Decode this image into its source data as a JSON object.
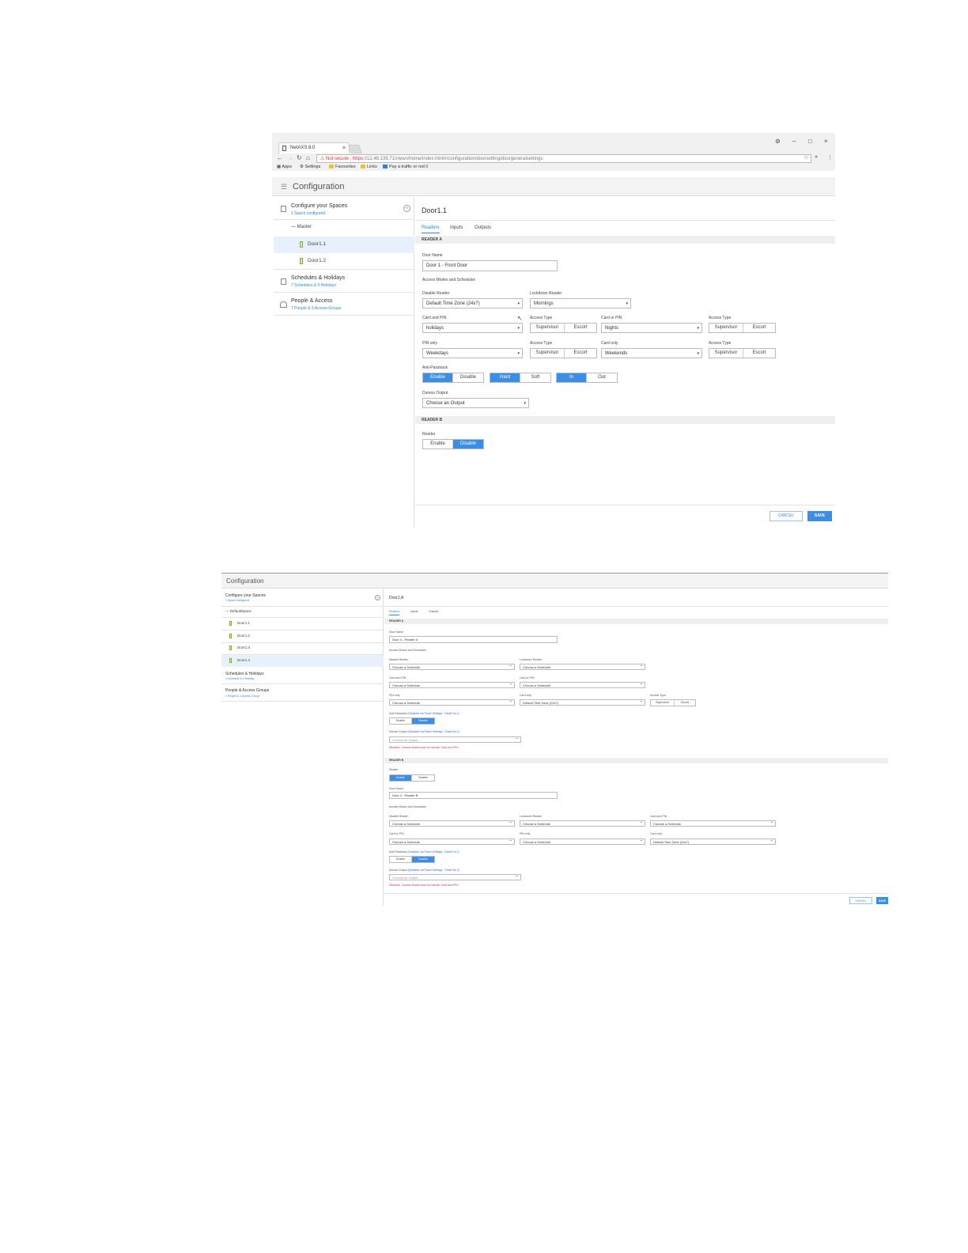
{
  "screen1": {
    "browser": {
      "tab_title": "NetAXS 8.0",
      "tab_close": "×",
      "window_controls": [
        "⊚",
        "–",
        "□",
        "×"
      ],
      "not_secure": "Not secure",
      "url_https": "https",
      "url_rest": "://12.48.139.71/views/home/index.html#/configuration/doorsetting/doorgeneralsettings",
      "bookmarks": [
        "Apps",
        "Settings",
        "Favourites",
        "Links",
        "Pay a traffic or red li"
      ]
    },
    "header": {
      "title": "Configuration"
    },
    "sidebar": {
      "spaces_title": "Configure your Spaces",
      "spaces_sub": "1 Space configured",
      "group": "— Master",
      "doors": [
        "Door1.1",
        "Door1.2"
      ],
      "schedules_title": "Schedules & Holidays",
      "schedules_sub": "7 Schedules & 5 Holidays",
      "people_title": "People & Access",
      "people_sub": "7 People & 3 Access Groups"
    },
    "main": {
      "door_title": "Door1.1",
      "tabs": [
        "Readers",
        "Inputs",
        "Outputs"
      ],
      "reader_a": "READER A",
      "door_name_label": "Door Name",
      "door_name_value": "Door 1 - Front Door",
      "access_modes_label": "Access Modes and Schedules",
      "disable_reader_label": "Disable Reader",
      "disable_reader_value": "Default Time Zone (24x7)",
      "lockdown_reader_label": "Lockdown Reader",
      "lockdown_reader_value": "Mornings",
      "card_and_pin_label": "Card and PIN",
      "card_and_pin_value": "holidays",
      "access_type_label": "Access Type",
      "supervisor": "Supervisor",
      "escort": "Escort",
      "card_or_pin_label": "Card or PIN",
      "card_or_pin_value": "Nights",
      "pin_only_label": "PIN only",
      "pin_only_value": "Weekdays",
      "card_only_label": "Card only",
      "card_only_value": "Weekends",
      "anti_passback_label": "Anti-Passback",
      "enable": "Enable",
      "disable": "Disable",
      "hard": "Hard",
      "soft": "Soft",
      "in": "In",
      "out": "Out",
      "duress_label": "Duress Output",
      "duress_value": "Choose an Output",
      "reader_b": "READER B",
      "reader_label": "Reader",
      "cancel": "CANCEL",
      "save": "SAVE"
    }
  },
  "screen2": {
    "header": {
      "title": "Configuration"
    },
    "sidebar": {
      "spaces_title": "Configure your Spaces",
      "spaces_sub": "1 Space configured",
      "group": "— DefaultSpace",
      "doors": [
        "Door1.1",
        "Door1.2",
        "Door1.3",
        "Door1.4"
      ],
      "schedules_title": "Schedules & Holidays",
      "schedules_sub": "1 Schedule & 0 Holiday",
      "people_title": "People & Access Groups",
      "people_sub": "1 People & 1 Access Group"
    },
    "main": {
      "door_title": "Door1.A",
      "tabs": [
        "Readers",
        "Inputs",
        "Outputs"
      ],
      "reader_a": "READER A",
      "door_name_label": "Door Name",
      "door_name_a": "Door 4 - Reader A",
      "access_modes_label": "Access Modes and Schedules",
      "disable_reader_label": "Disable Reader",
      "lockdown_reader_label": "Lockdown Reader",
      "card_pin_label": "Card and PIN",
      "card_or_pin_label": "Card or PIN",
      "pin_only_label": "PIN only",
      "card_only_label": "Card only",
      "access_type_label": "Access Type",
      "choose_schedule": "Choose a Schedule",
      "default_tz": "Default Time Zone (24x7)",
      "supervisor": "Supervisor",
      "escort": "Escort",
      "anti_passback_label": "Anti-Passback",
      "disabled_panel": "(Disabled via Panel Settings - Panel No 1)",
      "enable": "Enable",
      "disable": "Disable",
      "duress_label": "Duress Output",
      "choose_output": "Choose an Output",
      "duress_error": "Disabled - Access Mode must not include 'Card and PIN'",
      "reader_b": "READER B",
      "reader_label": "Reader",
      "door_name_b": "Door 4 - Reader B",
      "cancel": "CANCEL",
      "save": "SAVE"
    }
  },
  "colors": {
    "accent": "#3a8ee6",
    "link": "#3a87c9",
    "error": "#d33333",
    "door_icon": "#7bb03c"
  }
}
